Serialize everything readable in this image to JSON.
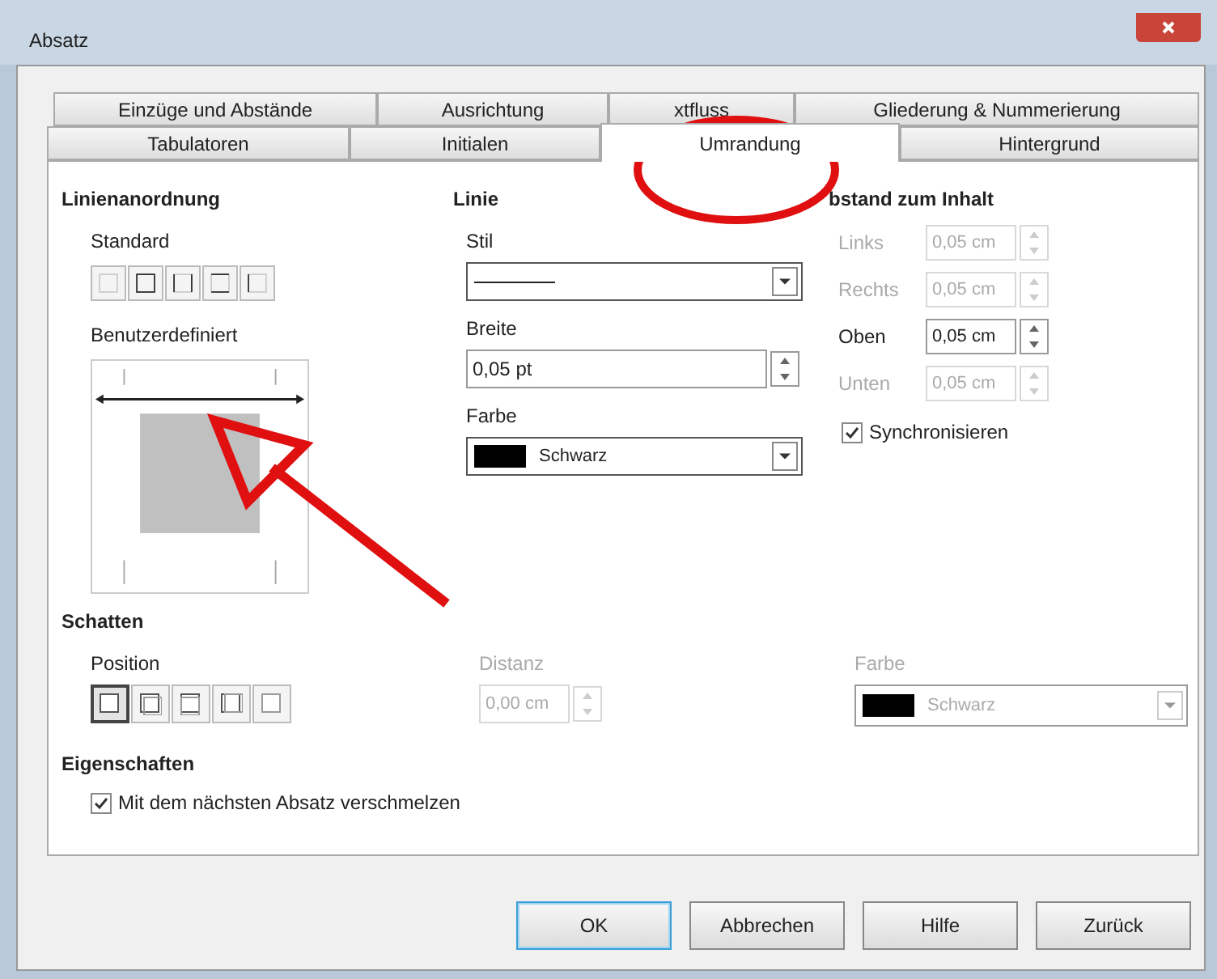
{
  "window": {
    "title": "Absatz"
  },
  "tab_rows": [
    {
      "tabs": [
        {
          "label": "Einzüge und Abstände",
          "selected": false
        },
        {
          "label": "Ausrichtung",
          "selected": false
        },
        {
          "label": "xtfluss",
          "selected": false
        },
        {
          "label": "Gliederung & Nummerierung",
          "selected": false
        }
      ]
    },
    {
      "tabs": [
        {
          "label": "Tabulatoren",
          "selected": false
        },
        {
          "label": "Initialen",
          "selected": false
        },
        {
          "label": "Umrandung",
          "selected": true
        },
        {
          "label": "Hintergrund",
          "selected": false
        }
      ]
    }
  ],
  "line_arrangement": {
    "heading": "Linienanordnung",
    "standard_label": "Standard",
    "custom_label": "Benutzerdefiniert"
  },
  "line": {
    "heading": "Linie",
    "style_label": "Stil",
    "width_label": "Breite",
    "width_value": "0,05 pt",
    "color_label": "Farbe",
    "color_value": "Schwarz"
  },
  "spacing": {
    "heading": "bstand zum Inhalt",
    "fields": [
      {
        "label": "Links",
        "value": "0,05 cm",
        "disabled": true
      },
      {
        "label": "Rechts",
        "value": "0,05 cm",
        "disabled": true
      },
      {
        "label": "Oben",
        "value": "0,05 cm",
        "disabled": false
      },
      {
        "label": "Unten",
        "value": "0,05 cm",
        "disabled": true
      }
    ],
    "sync": {
      "label": "Synchronisieren",
      "checked": true
    }
  },
  "shadow": {
    "heading": "Schatten",
    "position_label": "Position",
    "positions": [
      {
        "selected": true
      },
      {
        "selected": false
      },
      {
        "selected": false
      },
      {
        "selected": false
      },
      {
        "selected": false
      }
    ],
    "distance_label": "Distanz",
    "distance_value": "0,00 cm",
    "distance_disabled": true,
    "color_label": "Farbe",
    "color_value": "Schwarz",
    "color_disabled": true
  },
  "properties": {
    "heading": "Eigenschaften",
    "merge": {
      "label": "Mit dem nächsten Absatz verschmelzen",
      "checked": true
    }
  },
  "buttons": [
    {
      "label": "OK",
      "default": true
    },
    {
      "label": "Abbrechen",
      "default": false
    },
    {
      "label": "Hilfe",
      "default": false
    },
    {
      "label": "Zurück",
      "default": false
    }
  ]
}
